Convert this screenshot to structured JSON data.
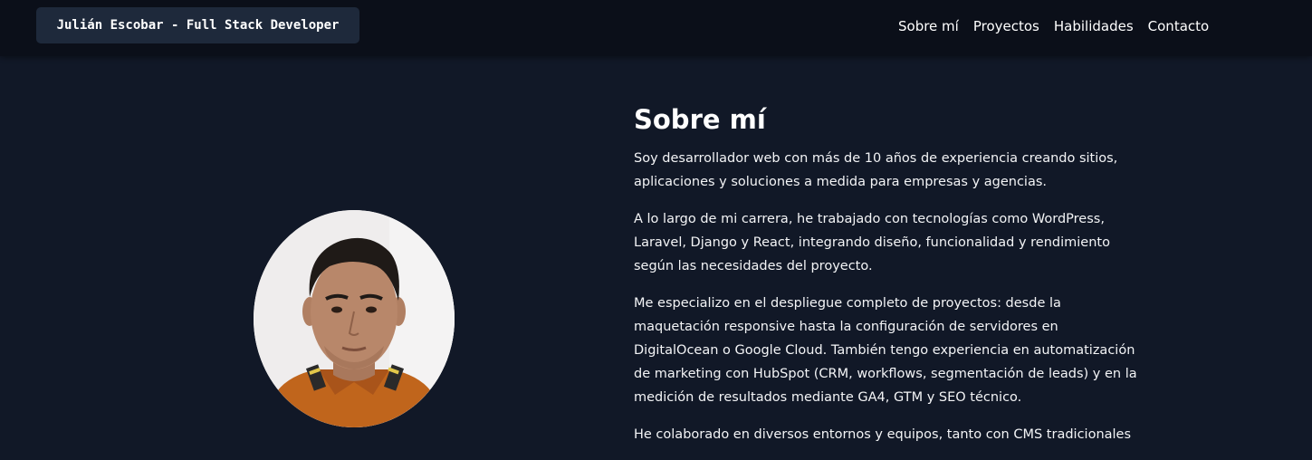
{
  "navbar": {
    "brand": "Julián Escobar - Full Stack Developer",
    "links": [
      "Sobre mí",
      "Proyectos",
      "Habilidades",
      "Contacto"
    ]
  },
  "about": {
    "title": "Sobre mí",
    "paragraphs": [
      [
        "Soy desarrollador web con más de 10 años de experiencia creando sitios,",
        "aplicaciones y soluciones a medida para empresas y agencias."
      ],
      [
        "A lo largo de mi carrera, he trabajado con tecnologías como WordPress,",
        "Laravel, Django y React, integrando diseño, funcionalidad y rendimiento",
        "según las necesidades del proyecto."
      ],
      [
        "Me especializo en el despliegue completo de proyectos: desde la",
        "maquetación responsive hasta la configuración de servidores en",
        "DigitalOcean o Google Cloud. También tengo experiencia en automatización",
        "de marketing con HubSpot (CRM, workflows, segmentación de leads) y en la",
        "medición de resultados mediante GA4, GTM y SEO técnico."
      ],
      [
        "He colaborado en diversos entornos y equipos, tanto con CMS tradicionales"
      ]
    ]
  },
  "profile_photo": {
    "icon": "profile-photo",
    "colors": {
      "background": "#efeded",
      "skin": "#b8876a",
      "hair": "#1f1a17",
      "shirt": "#c0651c"
    }
  },
  "colors": {
    "page_background": "#111827",
    "navbar_background": "#0b0f19",
    "brand_background": "#1e293b",
    "text": "#f3f4f6"
  }
}
